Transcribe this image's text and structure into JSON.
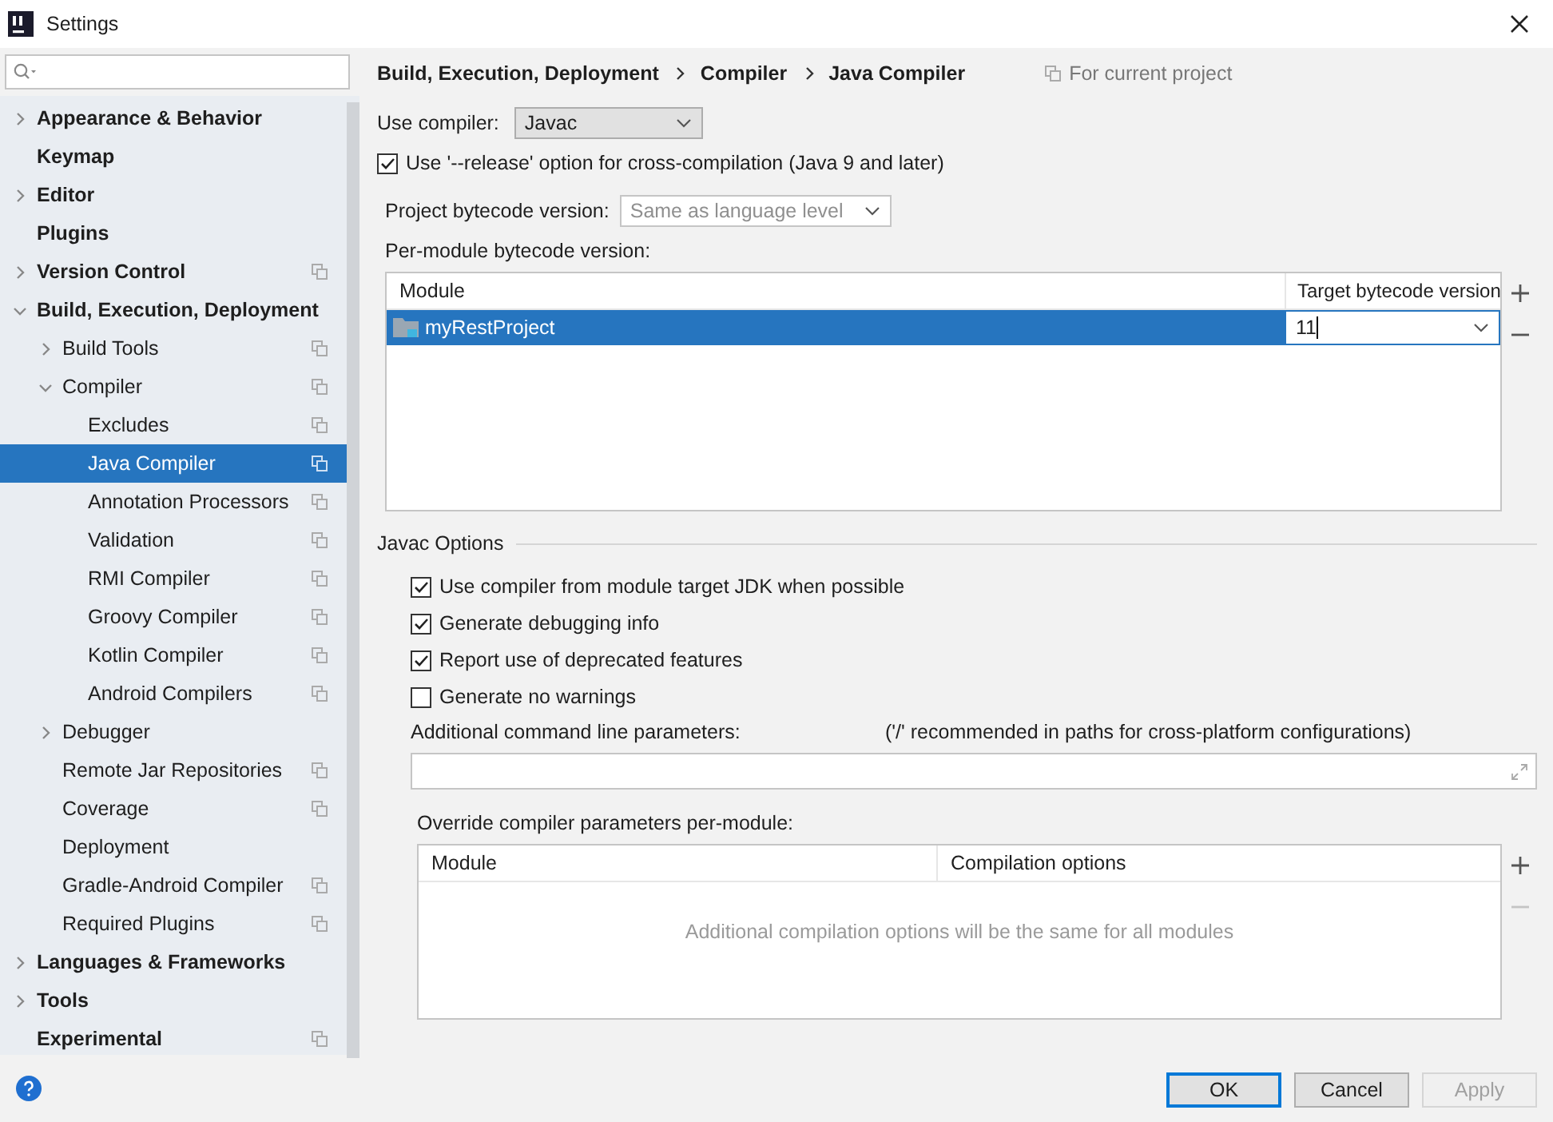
{
  "window": {
    "title": "Settings"
  },
  "tree": [
    {
      "label": "Appearance & Behavior",
      "kind": "folder",
      "expanded": false,
      "project_icon": false,
      "selected": false
    },
    {
      "label": "Keymap",
      "kind": "page",
      "project_icon": false,
      "selected": false
    },
    {
      "label": "Editor",
      "kind": "folder",
      "expanded": false,
      "project_icon": false,
      "selected": false
    },
    {
      "label": "Plugins",
      "kind": "page",
      "project_icon": false,
      "selected": false
    },
    {
      "label": "Version Control",
      "kind": "folder",
      "expanded": false,
      "project_icon": true,
      "selected": false
    },
    {
      "label": "Build, Execution, Deployment",
      "kind": "folder",
      "expanded": true,
      "project_icon": false,
      "selected": false,
      "children": [
        {
          "label": "Build Tools",
          "kind": "folder",
          "expanded": false,
          "project_icon": true,
          "selected": false
        },
        {
          "label": "Compiler",
          "kind": "folder",
          "expanded": true,
          "project_icon": true,
          "selected": false,
          "children": [
            {
              "label": "Excludes",
              "kind": "page",
              "project_icon": true,
              "selected": false
            },
            {
              "label": "Java Compiler",
              "kind": "page",
              "project_icon": true,
              "selected": true
            },
            {
              "label": "Annotation Processors",
              "kind": "page",
              "project_icon": true,
              "selected": false
            },
            {
              "label": "Validation",
              "kind": "page",
              "project_icon": true,
              "selected": false
            },
            {
              "label": "RMI Compiler",
              "kind": "page",
              "project_icon": true,
              "selected": false
            },
            {
              "label": "Groovy Compiler",
              "kind": "page",
              "project_icon": true,
              "selected": false
            },
            {
              "label": "Kotlin Compiler",
              "kind": "page",
              "project_icon": true,
              "selected": false
            },
            {
              "label": "Android Compilers",
              "kind": "page",
              "project_icon": true,
              "selected": false
            }
          ]
        },
        {
          "label": "Debugger",
          "kind": "folder",
          "expanded": false,
          "project_icon": false,
          "selected": false
        },
        {
          "label": "Remote Jar Repositories",
          "kind": "page",
          "project_icon": true,
          "selected": false
        },
        {
          "label": "Coverage",
          "kind": "page",
          "project_icon": true,
          "selected": false
        },
        {
          "label": "Deployment",
          "kind": "page",
          "project_icon": false,
          "selected": false
        },
        {
          "label": "Gradle-Android Compiler",
          "kind": "page",
          "project_icon": true,
          "selected": false
        },
        {
          "label": "Required Plugins",
          "kind": "page",
          "project_icon": true,
          "selected": false
        }
      ]
    },
    {
      "label": "Languages & Frameworks",
      "kind": "folder",
      "expanded": false,
      "project_icon": false,
      "selected": false
    },
    {
      "label": "Tools",
      "kind": "folder",
      "expanded": false,
      "project_icon": false,
      "selected": false
    },
    {
      "label": "Experimental",
      "kind": "page",
      "project_icon": true,
      "selected": false
    }
  ],
  "breadcrumb": [
    "Build, Execution, Deployment",
    "Compiler",
    "Java Compiler"
  ],
  "scope_label": "For current project",
  "use_compiler": {
    "label": "Use compiler:",
    "value": "Javac"
  },
  "release_option": {
    "label": "Use '--release' option for cross-compilation (Java 9 and later)",
    "checked": true
  },
  "project_bytecode": {
    "label": "Project bytecode version:",
    "value": "Same as language level",
    "disabled": true
  },
  "per_module": {
    "label": "Per-module bytecode version:",
    "columns": [
      "Module",
      "Target bytecode version"
    ],
    "rows": [
      {
        "module": "myRestProject",
        "target": "11",
        "selected": true
      }
    ],
    "remove_enabled": true
  },
  "javac_options": {
    "title": "Javac Options",
    "checkboxes": [
      {
        "label": "Use compiler from module target JDK when possible",
        "checked": true
      },
      {
        "label": "Generate debugging info",
        "checked": true
      },
      {
        "label": "Report use of deprecated features",
        "checked": true
      },
      {
        "label": "Generate no warnings",
        "checked": false
      }
    ],
    "params_label": "Additional command line parameters:",
    "params_hint": "('/' recommended in paths for cross-platform configurations)"
  },
  "override": {
    "label": "Override compiler parameters per-module:",
    "columns": [
      "Module",
      "Compilation options"
    ],
    "empty_text": "Additional compilation options will be the same for all modules",
    "remove_enabled": false
  },
  "buttons": [
    {
      "label": "OK",
      "kind": "default"
    },
    {
      "label": "Cancel",
      "kind": "normal"
    },
    {
      "label": "Apply",
      "kind": "disabled"
    }
  ]
}
